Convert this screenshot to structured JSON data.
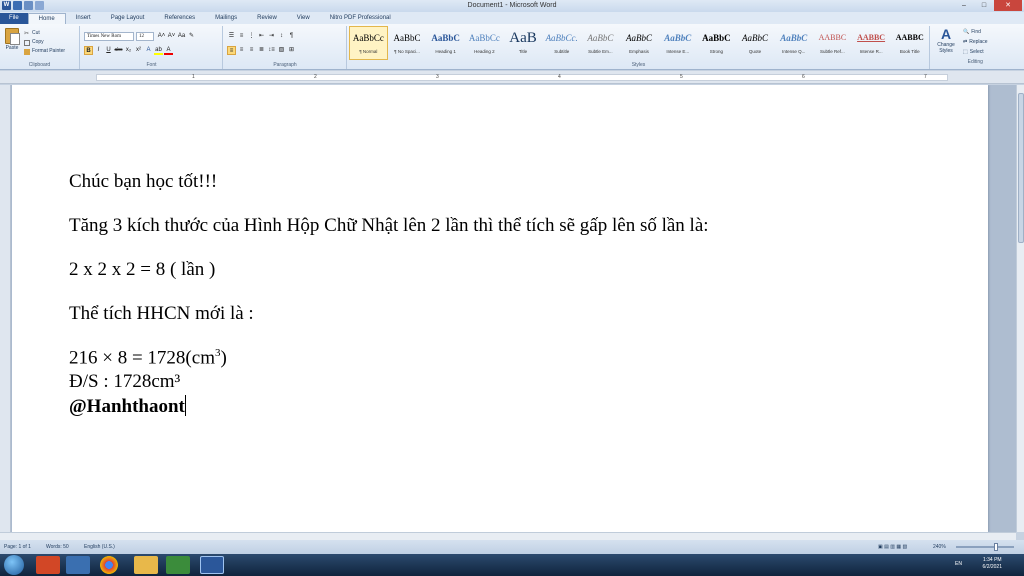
{
  "window": {
    "title": "Document1 - Microsoft Word"
  },
  "tabs": [
    "File",
    "Home",
    "Insert",
    "Page Layout",
    "References",
    "Mailings",
    "Review",
    "View",
    "Nitro PDF Professional"
  ],
  "ribbon": {
    "clipboard": {
      "paste": "Paste",
      "cut": "Cut",
      "copy": "Copy",
      "format_painter": "Format Painter",
      "label": "Clipboard"
    },
    "font": {
      "name": "Times New Rom",
      "size": "12",
      "label": "Font"
    },
    "paragraph": {
      "label": "Paragraph"
    },
    "styles": {
      "label": "Styles",
      "items": [
        {
          "sample": "AaBbCc",
          "name": "¶ Normal"
        },
        {
          "sample": "AaBbC",
          "name": "¶ No Spaci..."
        },
        {
          "sample": "AaBbC",
          "name": "Heading 1"
        },
        {
          "sample": "AaBbCc",
          "name": "Heading 2"
        },
        {
          "sample": "AaB",
          "name": "Title"
        },
        {
          "sample": "AaBbCc.",
          "name": "Subtitle"
        },
        {
          "sample": "AaBbC",
          "name": "Subtle Em..."
        },
        {
          "sample": "AaBbC",
          "name": "Emphasis"
        },
        {
          "sample": "AaBbC",
          "name": "Intense E..."
        },
        {
          "sample": "AaBbC",
          "name": "Strong"
        },
        {
          "sample": "AaBbC",
          "name": "Quote"
        },
        {
          "sample": "AaBbC",
          "name": "Intense Q..."
        },
        {
          "sample": "AABBC",
          "name": "Subtle Ref..."
        },
        {
          "sample": "AABBC",
          "name": "Intense R..."
        },
        {
          "sample": "AABBC",
          "name": "Book Title"
        }
      ]
    },
    "change_styles": "Change Styles",
    "editing": {
      "find": "Find",
      "replace": "Replace",
      "select": "Select",
      "label": "Editing"
    }
  },
  "ruler_numbers": [
    "1",
    "2",
    "3",
    "4",
    "5",
    "6",
    "7"
  ],
  "document": {
    "line1": "Chúc bạn học tốt!!!",
    "line2": "Tăng 3 kích thước của Hình Hộp Chữ Nhật lên 2 lần thì thể tích sẽ gấp lên số lần là:",
    "line3": "2 x 2 x 2 =  8 ( lần )",
    "line4": "Thể tích HHCN mới là :",
    "line5_main": "216 × 8 = 1728(cm",
    "line5_sup": "3",
    "line5_end": ")",
    "line6": "Đ/S : 1728cm³",
    "line7": "@Hanhthaont"
  },
  "statusbar": {
    "page": "Page: 1 of 1",
    "words": "Words: 50",
    "language": "English (U.S.)",
    "zoom": "240%"
  },
  "taskbar": {
    "lang": "EN",
    "time": "1:34 PM",
    "date": "6/2/2021"
  }
}
